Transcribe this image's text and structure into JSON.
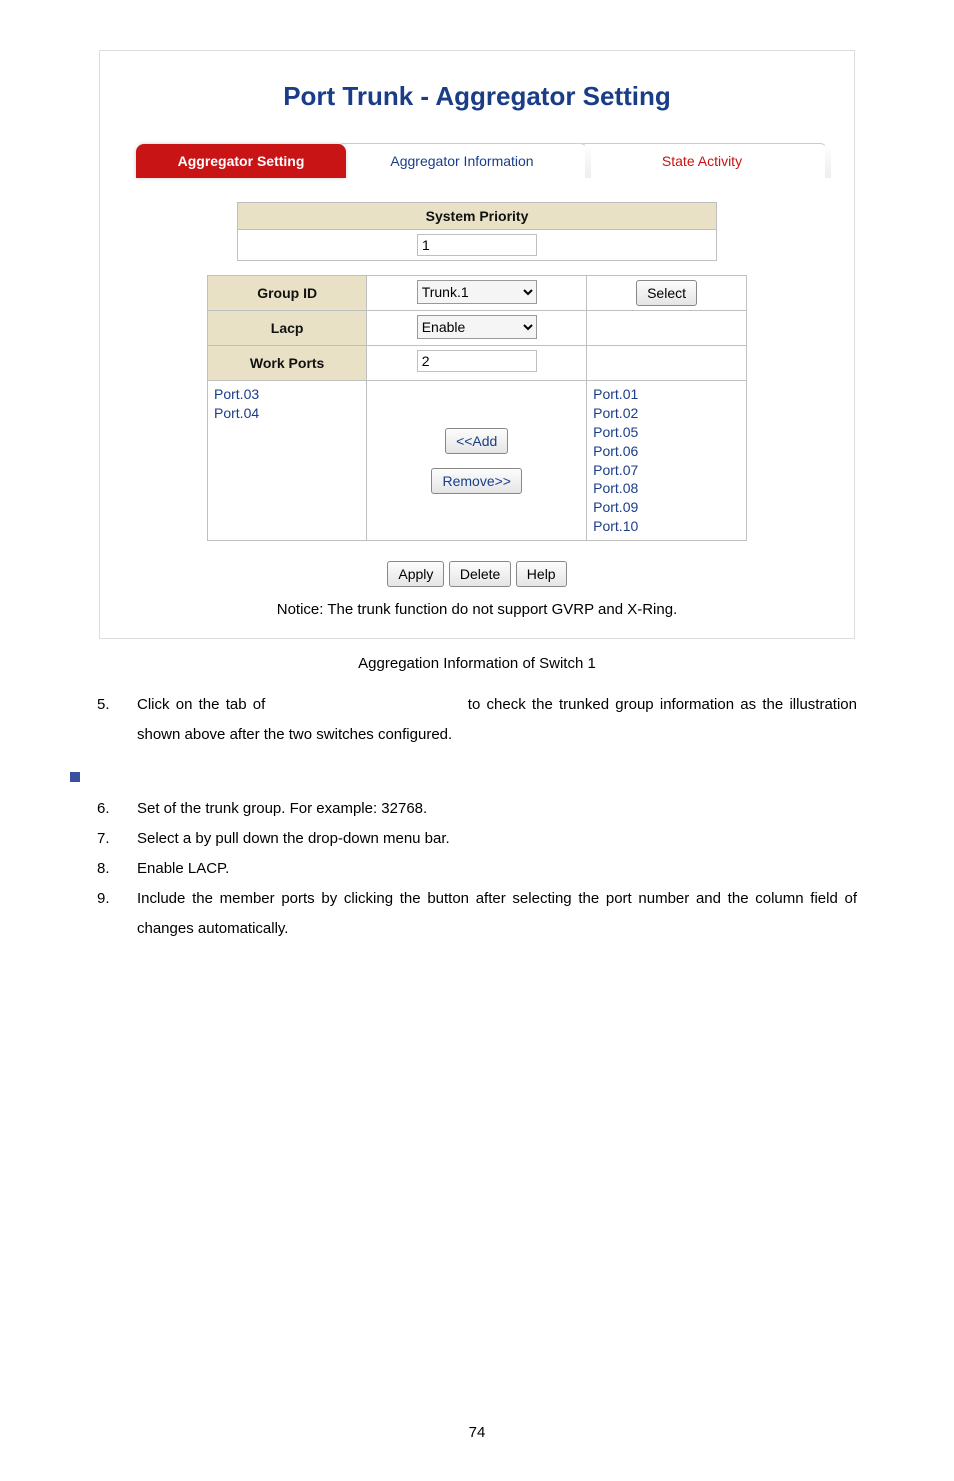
{
  "shot": {
    "title": "Port Trunk - Aggregator Setting",
    "tabs": {
      "active": "Aggregator Setting",
      "mid": "Aggregator Information",
      "end": "State Activity"
    },
    "system_priority_label": "System Priority",
    "system_priority_value": "1",
    "rows": {
      "group_id_label": "Group ID",
      "group_id_value": "Trunk.1",
      "select_btn": "Select",
      "lacp_label": "Lacp",
      "lacp_value": "Enable",
      "work_ports_label": "Work Ports",
      "work_ports_value": "2",
      "left_ports": [
        "Port.03",
        "Port.04"
      ],
      "add_btn": "<<Add",
      "remove_btn": "Remove>>",
      "right_ports": [
        "Port.01",
        "Port.02",
        "Port.05",
        "Port.06",
        "Port.07",
        "Port.08",
        "Port.09",
        "Port.10"
      ]
    },
    "apply_btn": "Apply",
    "delete_btn": "Delete",
    "help_btn": "Help",
    "notice": "Notice: The trunk function do not support GVRP and X-Ring."
  },
  "caption": "Aggregation Information of Switch 1",
  "list_top": {
    "num": "5.",
    "text_before": "Click on the tab of ",
    "text_after": " to check the trunked group information as the illustration shown above after the two switches configured."
  },
  "section2": {
    "i6": {
      "num": "6.",
      "text": "Set                          of the trunk group. For example: 32768."
    },
    "i7": {
      "num": "7.",
      "text": "Select a                        by pull down the drop-down menu bar."
    },
    "i8": {
      "num": "8.",
      "text": "Enable LACP."
    },
    "i9": {
      "num": "9.",
      "text": "Include the member ports by clicking the        button after selecting the port number and the column field of                      changes automatically."
    }
  },
  "page_number": "74"
}
